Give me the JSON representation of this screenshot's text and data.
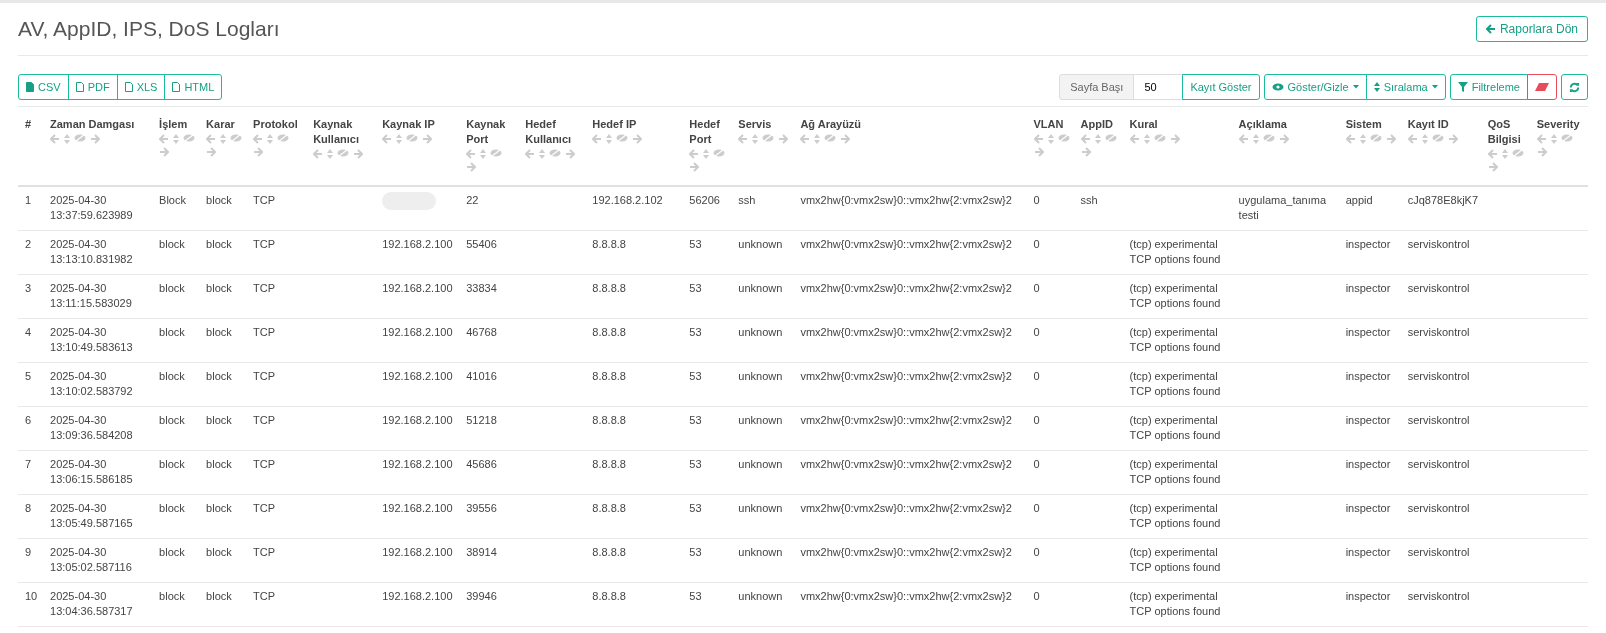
{
  "page": {
    "title": "AV, AppID, IPS, DoS Logları",
    "back_button": "Raporlara Dön"
  },
  "export_buttons": [
    "CSV",
    "PDF",
    "XLS",
    "HTML"
  ],
  "toolbar": {
    "page_size_label": "Sayfa Başı",
    "page_size_value": "50",
    "show_records_button": "Kayıt Göster",
    "show_hide_button": "Göster/Gizle",
    "sort_button": "Sıralama",
    "filter_button": "Filtreleme"
  },
  "table": {
    "columns": [
      {
        "label": "#",
        "tools": false
      },
      {
        "label": "Zaman Damgası",
        "tools": true
      },
      {
        "label": "İşlem",
        "tools": true
      },
      {
        "label": "Karar",
        "tools": true
      },
      {
        "label": "Protokol",
        "tools": true
      },
      {
        "label": "Kaynak Kullanıcı",
        "tools": true
      },
      {
        "label": "Kaynak IP",
        "tools": true
      },
      {
        "label": "Kaynak Port",
        "tools": true
      },
      {
        "label": "Hedef Kullanıcı",
        "tools": true
      },
      {
        "label": "Hedef IP",
        "tools": true
      },
      {
        "label": "Hedef Port",
        "tools": true
      },
      {
        "label": "Servis",
        "tools": true
      },
      {
        "label": "Ağ Arayüzü",
        "tools": true
      },
      {
        "label": "VLAN",
        "tools": true
      },
      {
        "label": "AppID",
        "tools": true
      },
      {
        "label": "Kural",
        "tools": true
      },
      {
        "label": "Açıklama",
        "tools": true
      },
      {
        "label": "Sistem",
        "tools": true
      },
      {
        "label": "Kayıt ID",
        "tools": true
      },
      {
        "label": "QoS Bilgisi",
        "tools": true
      },
      {
        "label": "Severity",
        "tools": true
      }
    ],
    "rows": [
      {
        "source_ip_redacted": true,
        "cells": [
          "1",
          "2025-04-30 13:37:59.623989",
          "Block",
          "block",
          "TCP",
          null,
          null,
          "22",
          null,
          "192.168.2.102",
          "56206",
          "ssh",
          "vmx2hw{0:vmx2sw}0::vmx2hw{2:vmx2sw}2",
          "0",
          "ssh",
          null,
          "uygulama_tanıma testi",
          "appid",
          "cJq878E8kjK7",
          null,
          null
        ]
      },
      {
        "source_ip_redacted": false,
        "cells": [
          "2",
          "2025-04-30 13:13:10.831982",
          "block",
          "block",
          "TCP",
          null,
          "192.168.2.100",
          "55406",
          null,
          "8.8.8.8",
          "53",
          "unknown",
          "vmx2hw{0:vmx2sw}0::vmx2hw{2:vmx2sw}2",
          "0",
          null,
          "(tcp) experimental TCP options found",
          null,
          "inspector",
          "serviskontrol",
          null,
          null
        ]
      },
      {
        "source_ip_redacted": false,
        "cells": [
          "3",
          "2025-04-30 13:11:15.583029",
          "block",
          "block",
          "TCP",
          null,
          "192.168.2.100",
          "33834",
          null,
          "8.8.8.8",
          "53",
          "unknown",
          "vmx2hw{0:vmx2sw}0::vmx2hw{2:vmx2sw}2",
          "0",
          null,
          "(tcp) experimental TCP options found",
          null,
          "inspector",
          "serviskontrol",
          null,
          null
        ]
      },
      {
        "source_ip_redacted": false,
        "cells": [
          "4",
          "2025-04-30 13:10:49.583613",
          "block",
          "block",
          "TCP",
          null,
          "192.168.2.100",
          "46768",
          null,
          "8.8.8.8",
          "53",
          "unknown",
          "vmx2hw{0:vmx2sw}0::vmx2hw{2:vmx2sw}2",
          "0",
          null,
          "(tcp) experimental TCP options found",
          null,
          "inspector",
          "serviskontrol",
          null,
          null
        ]
      },
      {
        "source_ip_redacted": false,
        "cells": [
          "5",
          "2025-04-30 13:10:02.583792",
          "block",
          "block",
          "TCP",
          null,
          "192.168.2.100",
          "41016",
          null,
          "8.8.8.8",
          "53",
          "unknown",
          "vmx2hw{0:vmx2sw}0::vmx2hw{2:vmx2sw}2",
          "0",
          null,
          "(tcp) experimental TCP options found",
          null,
          "inspector",
          "serviskontrol",
          null,
          null
        ]
      },
      {
        "source_ip_redacted": false,
        "cells": [
          "6",
          "2025-04-30 13:09:36.584208",
          "block",
          "block",
          "TCP",
          null,
          "192.168.2.100",
          "51218",
          null,
          "8.8.8.8",
          "53",
          "unknown",
          "vmx2hw{0:vmx2sw}0::vmx2hw{2:vmx2sw}2",
          "0",
          null,
          "(tcp) experimental TCP options found",
          null,
          "inspector",
          "serviskontrol",
          null,
          null
        ]
      },
      {
        "source_ip_redacted": false,
        "cells": [
          "7",
          "2025-04-30 13:06:15.586185",
          "block",
          "block",
          "TCP",
          null,
          "192.168.2.100",
          "45686",
          null,
          "8.8.8.8",
          "53",
          "unknown",
          "vmx2hw{0:vmx2sw}0::vmx2hw{2:vmx2sw}2",
          "0",
          null,
          "(tcp) experimental TCP options found",
          null,
          "inspector",
          "serviskontrol",
          null,
          null
        ]
      },
      {
        "source_ip_redacted": false,
        "cells": [
          "8",
          "2025-04-30 13:05:49.587165",
          "block",
          "block",
          "TCP",
          null,
          "192.168.2.100",
          "39556",
          null,
          "8.8.8.8",
          "53",
          "unknown",
          "vmx2hw{0:vmx2sw}0::vmx2hw{2:vmx2sw}2",
          "0",
          null,
          "(tcp) experimental TCP options found",
          null,
          "inspector",
          "serviskontrol",
          null,
          null
        ]
      },
      {
        "source_ip_redacted": false,
        "cells": [
          "9",
          "2025-04-30 13:05:02.587116",
          "block",
          "block",
          "TCP",
          null,
          "192.168.2.100",
          "38914",
          null,
          "8.8.8.8",
          "53",
          "unknown",
          "vmx2hw{0:vmx2sw}0::vmx2hw{2:vmx2sw}2",
          "0",
          null,
          "(tcp) experimental TCP options found",
          null,
          "inspector",
          "serviskontrol",
          null,
          null
        ]
      },
      {
        "source_ip_redacted": false,
        "cells": [
          "10",
          "2025-04-30 13:04:36.587317",
          "block",
          "block",
          "TCP",
          null,
          "192.168.2.100",
          "39946",
          null,
          "8.8.8.8",
          "53",
          "unknown",
          "vmx2hw{0:vmx2sw}0::vmx2hw{2:vmx2sw}2",
          "0",
          null,
          "(tcp) experimental TCP options found",
          null,
          "inspector",
          "serviskontrol",
          null,
          null
        ]
      }
    ]
  }
}
